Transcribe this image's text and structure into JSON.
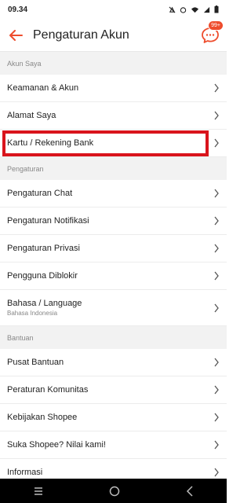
{
  "status": {
    "time": "09.34"
  },
  "header": {
    "title": "Pengaturan Akun",
    "chat_badge": "99+"
  },
  "sections": [
    {
      "title": "Akun Saya",
      "items": [
        {
          "label": "Keamanan & Akun"
        },
        {
          "label": "Alamat Saya"
        },
        {
          "label": "Kartu / Rekening Bank"
        }
      ]
    },
    {
      "title": "Pengaturan",
      "items": [
        {
          "label": "Pengaturan Chat"
        },
        {
          "label": "Pengaturan Notifikasi"
        },
        {
          "label": "Pengaturan Privasi"
        },
        {
          "label": "Pengguna Diblokir"
        },
        {
          "label": "Bahasa / Language",
          "sub": "Bahasa Indonesia"
        }
      ]
    },
    {
      "title": "Bantuan",
      "items": [
        {
          "label": "Pusat Bantuan"
        },
        {
          "label": "Peraturan Komunitas"
        },
        {
          "label": "Kebijakan Shopee"
        },
        {
          "label": "Suka Shopee? Nilai kami!"
        },
        {
          "label": "Informasi"
        }
      ]
    }
  ],
  "colors": {
    "accent": "#ee4d2d",
    "highlight": "#d9141c"
  }
}
